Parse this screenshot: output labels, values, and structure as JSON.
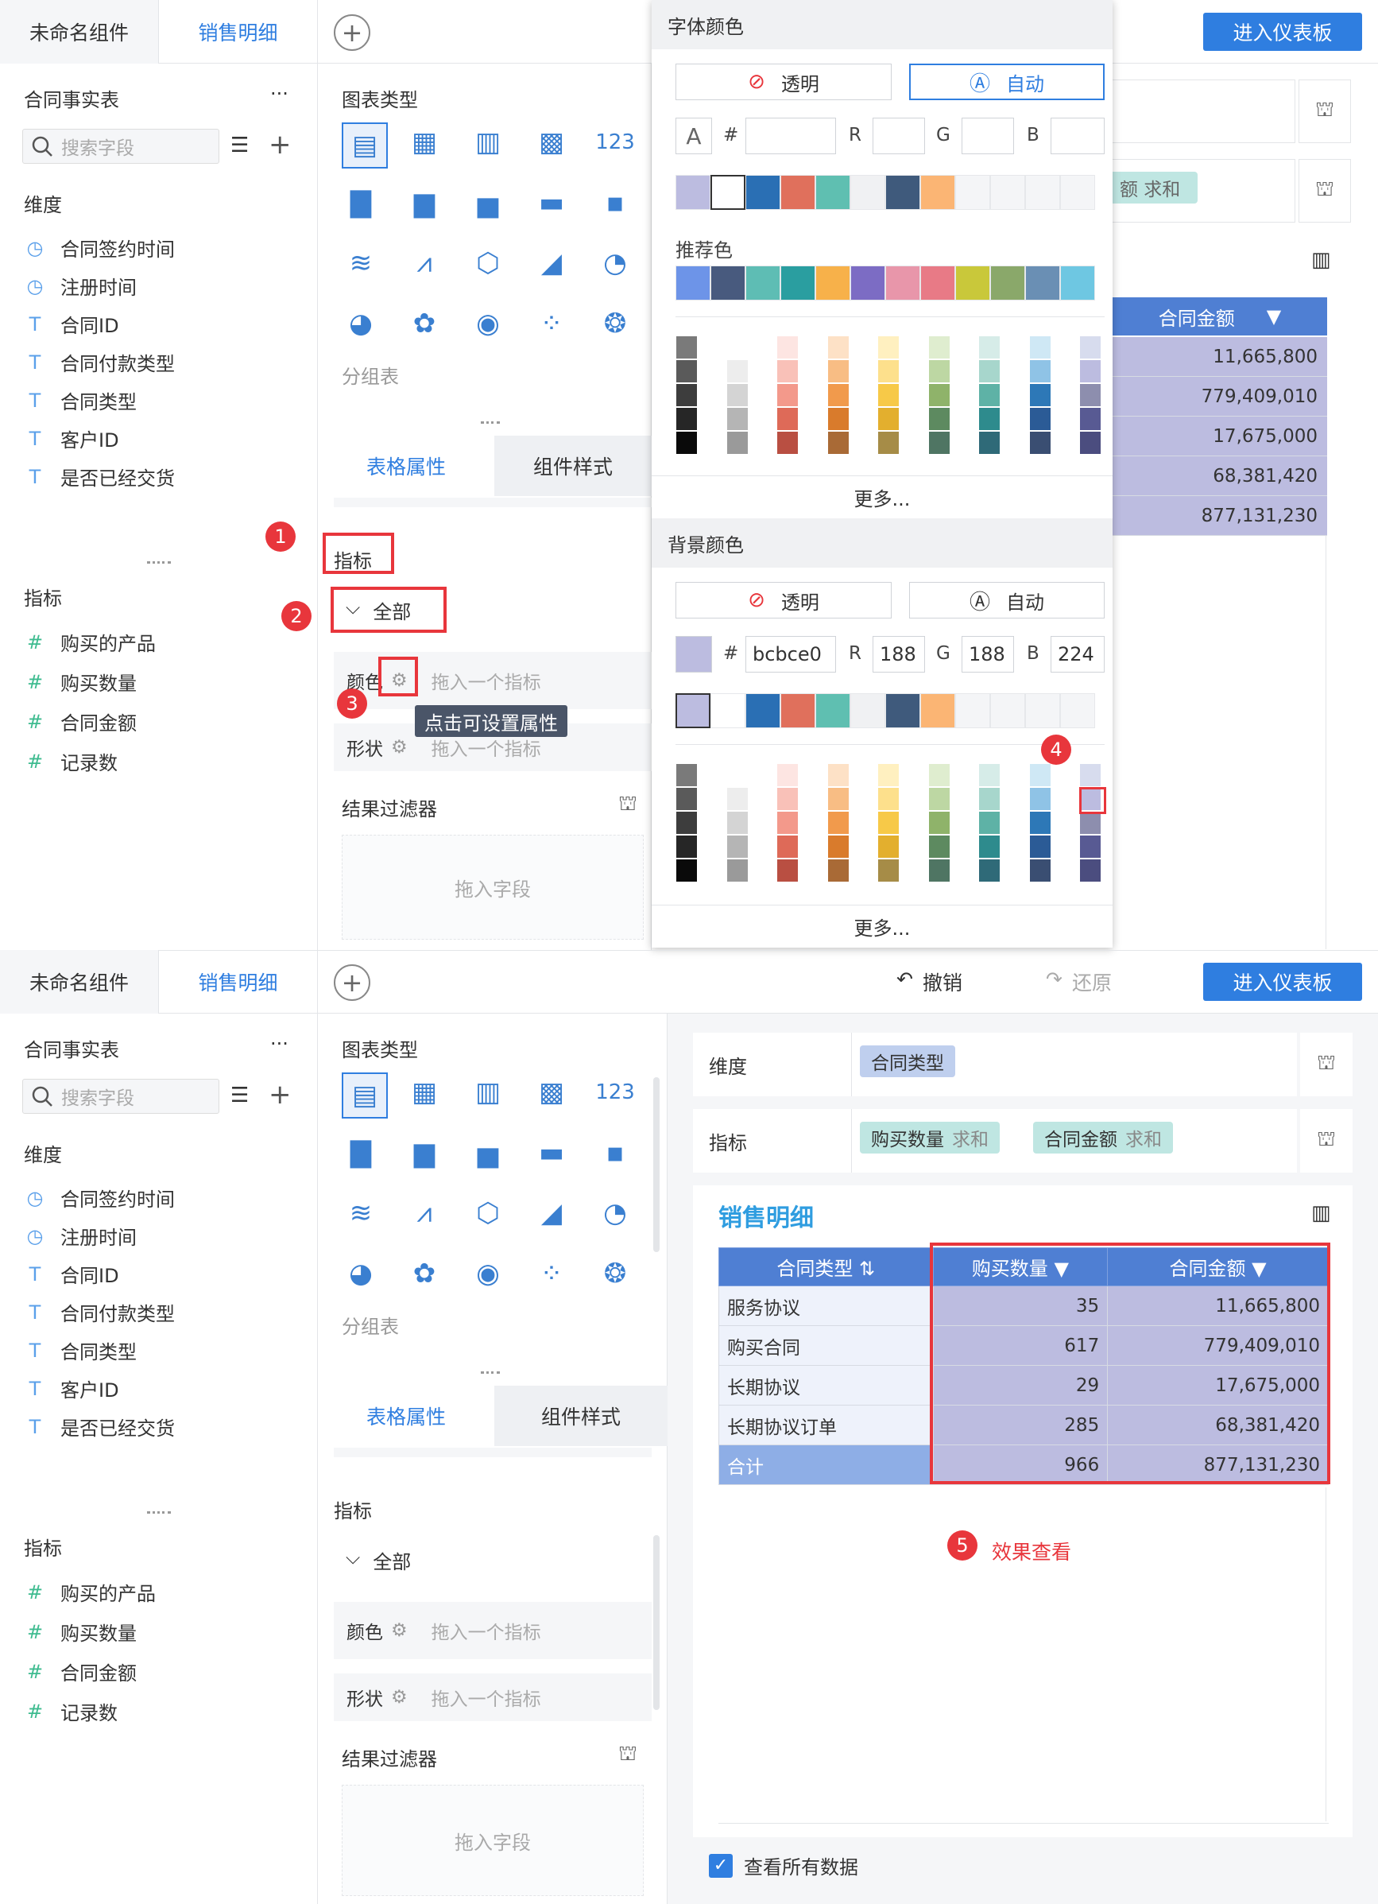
{
  "top": {
    "tabs": [
      "未命名组件",
      "销售明细"
    ],
    "enter_btn": "进入仪表板",
    "undo": "撤销",
    "redo": "还原"
  },
  "left": {
    "table_name": "合同事实表",
    "more": "···",
    "search_placeholder": "搜索字段",
    "dim_title": "维度",
    "dims": [
      "合同签约时间",
      "注册时间",
      "合同ID",
      "合同付款类型",
      "合同类型",
      "客户ID",
      "是否已经交货"
    ],
    "dim_icons": [
      "clock",
      "clock",
      "T",
      "T",
      "T",
      "T",
      "T"
    ],
    "metric_title": "指标",
    "metrics": [
      "购买的产品",
      "购买数量",
      "合同金额",
      "记录数"
    ]
  },
  "mid": {
    "chart_type_title": "图表类型",
    "group_table": "分组表",
    "tabs": [
      "表格属性",
      "组件样式"
    ],
    "metric_label": "指标",
    "all_label": "全部",
    "color_label": "颜色",
    "shape_label": "形状",
    "drop_metric": "拖入一个指标",
    "tooltip": "点击可设置属性",
    "filter_title": "结果过滤器",
    "drop_field": "拖入字段"
  },
  "popup": {
    "font_color_title": "字体颜色",
    "bg_color_title": "背景颜色",
    "transparent": "透明",
    "auto": "自动",
    "hash": "#",
    "r": "R",
    "g": "G",
    "b": "B",
    "hex_value": "bcbce0",
    "r_value": "188",
    "g_value": "188",
    "b_value": "224",
    "recommended": "推荐色",
    "more": "更多...",
    "recent_colors": [
      "#bcbce0",
      "#ffffff",
      "#2a6fb4",
      "#e0705c",
      "#5fbfb1",
      "#f0f1f3",
      "#3f5a7c",
      "#fbb574",
      "#f4f5f7",
      "#f4f5f7",
      "#f4f5f7",
      "#f4f5f7"
    ],
    "recommend_colors": [
      "#6d94e8",
      "#485a7e",
      "#5ebdb4",
      "#2a9ea0",
      "#f7b14a",
      "#7c6cc4",
      "#e896aa",
      "#e87a86",
      "#c9c83a",
      "#8aa86a",
      "#6a8fb4",
      "#6ec7e2"
    ],
    "palette_cols": [
      [
        "#7a7a7a",
        "#5a5a5a",
        "#3d3d3d",
        "#262626",
        "#0a0a0a"
      ],
      [
        "#ffffff",
        "#ededed",
        "#d4d4d4",
        "#b5b5b5",
        "#9a9a9a"
      ],
      [
        "#fde5e2",
        "#f9c1b8",
        "#f3998b",
        "#de6a58",
        "#b94f42"
      ],
      [
        "#fde1c6",
        "#f8bd84",
        "#f19a4c",
        "#d97b2c",
        "#a96a36"
      ],
      [
        "#fff0c0",
        "#fde08c",
        "#f7c948",
        "#e3af2e",
        "#a68c47"
      ],
      [
        "#dfedcf",
        "#bdd7a3",
        "#8fb36a",
        "#5d8a60",
        "#4f7563"
      ],
      [
        "#d6ece8",
        "#a7d6cc",
        "#5eb2a6",
        "#2e8b8d",
        "#2f6a78"
      ],
      [
        "#cfe8f5",
        "#8fc3e6",
        "#2d78b7",
        "#2b5b96",
        "#3a4e72"
      ],
      [
        "#d7dcee",
        "#bcbce0",
        "#8d8eae",
        "#585a93",
        "#4b4d7f"
      ]
    ]
  },
  "right": {
    "dim_label": "维度",
    "metric_label": "指标",
    "dim_chip": "合同类型",
    "metric_chips": [
      {
        "name": "购买数量",
        "agg": "求和"
      },
      {
        "name": "合同金额",
        "agg": "求和"
      }
    ],
    "widget_title": "销售明细",
    "table": {
      "headers": [
        "合同类型",
        "购买数量",
        "合同金额"
      ],
      "rows": [
        [
          "服务协议",
          "35",
          "11,665,800"
        ],
        [
          "购买合同",
          "617",
          "779,409,010"
        ],
        [
          "长期协议",
          "29",
          "17,675,000"
        ],
        [
          "长期协议订单",
          "285",
          "68,381,420"
        ],
        [
          "合计",
          "966",
          "877,131,230"
        ]
      ]
    },
    "effect_label": "效果查看",
    "view_all": "查看所有数据",
    "partial_chip": "额 求和"
  },
  "steps": [
    "1",
    "2",
    "3",
    "4",
    "5"
  ],
  "colors": {
    "accent": "#2f7ee0",
    "header": "#4f7fd3",
    "cell": "#bcbce0",
    "badge": "#e8363c"
  }
}
